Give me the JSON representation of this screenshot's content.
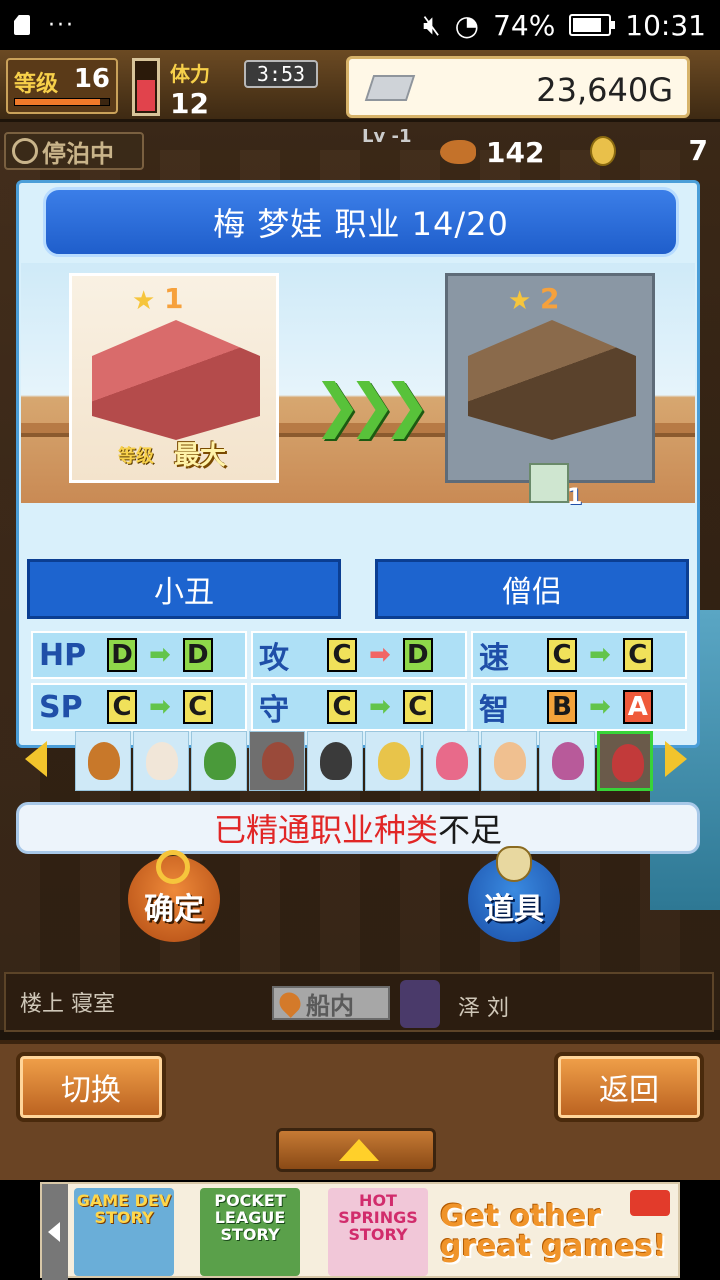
{
  "status_bar": {
    "dots": "···",
    "battery": "74%",
    "time": "10:31"
  },
  "hud": {
    "level_label": "等级",
    "level": "16",
    "stamina_label": "体力",
    "stamina": "12",
    "timer": "3:53",
    "gold": "23,640G",
    "moor_status": "停泊中",
    "ship_level": "Lv -1",
    "food": "142",
    "coins": "7"
  },
  "dialog": {
    "title": "梅 梦娃  职业 14/20",
    "current_room": {
      "stars": "1",
      "level_label": "等级",
      "max_label": "最大"
    },
    "next_room": {
      "stars": "2",
      "item_count": "1"
    },
    "job_from": "小丑",
    "job_to": "僧侣",
    "stats": [
      {
        "name": "HP",
        "from": "D",
        "to": "D"
      },
      {
        "name": "攻",
        "from": "C",
        "to": "D"
      },
      {
        "name": "速",
        "from": "C",
        "to": "C"
      },
      {
        "name": "SP",
        "from": "C",
        "to": "C"
      },
      {
        "name": "守",
        "from": "C",
        "to": "C"
      },
      {
        "name": "智",
        "from": "B",
        "to": "A"
      }
    ]
  },
  "warning": {
    "red_part": "已精通职业种类",
    "black_part": "不足"
  },
  "actions": {
    "confirm": "确定",
    "items": "道具"
  },
  "room_info": {
    "location": "楼上 寝室",
    "ship_tag": "船内",
    "character": "泽 刘"
  },
  "bottom": {
    "switch": "切换",
    "back": "返回"
  },
  "ad": {
    "game1": "GAME DEV STORY",
    "game2": "POCKET LEAGUE STORY",
    "game3": "HOT SPRINGS STORY",
    "cta_line1": "Get other",
    "cta_line2": "great games!"
  }
}
